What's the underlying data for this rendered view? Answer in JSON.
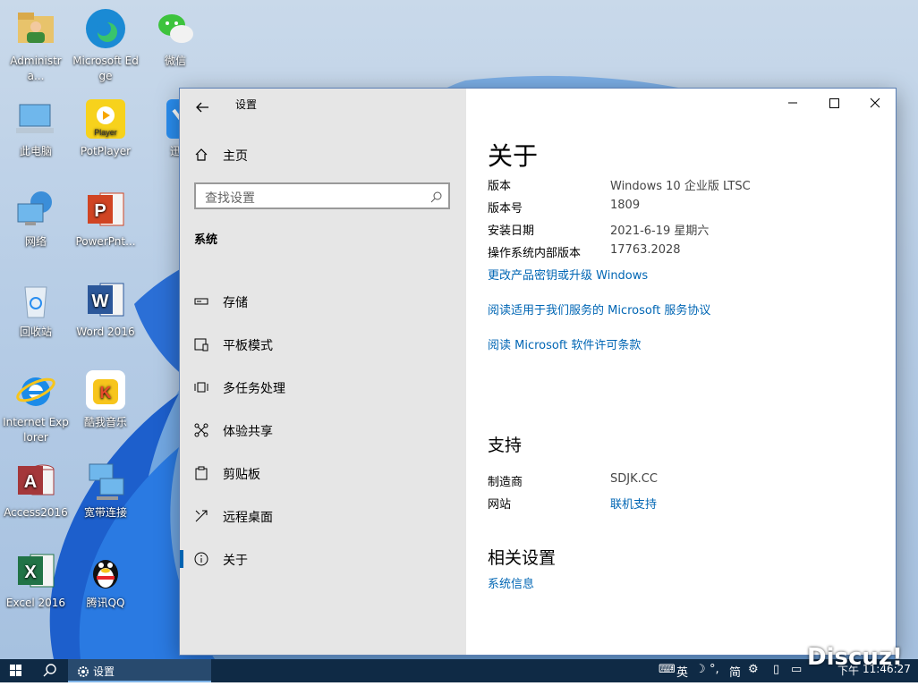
{
  "desktop": {
    "icons": [
      {
        "label": "Administra..."
      },
      {
        "label": "Microsoft Edge"
      },
      {
        "label": "微信"
      },
      {
        "label": "此电脑"
      },
      {
        "label": "PotPlayer"
      },
      {
        "label": "迅"
      },
      {
        "label": "网络"
      },
      {
        "label": "PowerPnt..."
      },
      {
        "label": "回收站"
      },
      {
        "label": "Word 2016"
      },
      {
        "label": "Internet Explorer"
      },
      {
        "label": "酷我音乐"
      },
      {
        "label": "Access2016"
      },
      {
        "label": "宽带连接"
      },
      {
        "label": "Excel 2016"
      },
      {
        "label": "腾讯QQ"
      }
    ]
  },
  "settings": {
    "title": "设置",
    "nav": {
      "home": "主页",
      "search_placeholder": "查找设置",
      "group": "系统",
      "items": [
        {
          "label": "存储"
        },
        {
          "label": "平板模式"
        },
        {
          "label": "多任务处理"
        },
        {
          "label": "体验共享"
        },
        {
          "label": "剪贴板"
        },
        {
          "label": "远程桌面"
        },
        {
          "label": "关于"
        }
      ]
    },
    "about": {
      "heading": "关于",
      "rows": [
        {
          "key": "版本",
          "value": "Windows 10 企业版 LTSC"
        },
        {
          "key": "版本号",
          "value": "1809"
        },
        {
          "key": "安装日期",
          "value": "2021-6-19 星期六"
        },
        {
          "key": "操作系统内部版本",
          "value": "17763.2028"
        }
      ],
      "links": [
        "更改产品密钥或升级 Windows",
        "阅读适用于我们服务的 Microsoft 服务协议",
        "阅读 Microsoft 软件许可条款"
      ]
    },
    "support": {
      "heading": "支持",
      "rows": [
        {
          "key": "制造商",
          "value": "SDJK.CC"
        },
        {
          "key": "网站",
          "value": "联机支持"
        }
      ]
    },
    "related": {
      "heading": "相关设置",
      "link": "系统信息"
    }
  },
  "taskbar": {
    "app_label": "设置",
    "ime_lang": "英",
    "ime_mode": "简",
    "clock_prefix": "下午",
    "clock": "11:46:27"
  },
  "watermark": "Discuz!",
  "colors": {
    "accent": "#0063b1",
    "link": "#0066b4",
    "taskbar": "#0f2a45"
  }
}
